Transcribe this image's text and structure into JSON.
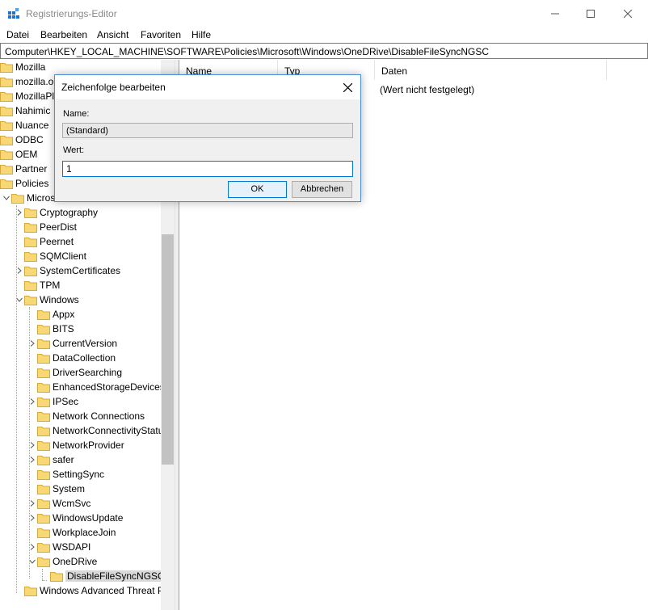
{
  "window": {
    "title": "Registrierungs-Editor"
  },
  "menu": [
    "Datei",
    "Bearbeiten",
    "Ansicht",
    "Favoriten",
    "Hilfe"
  ],
  "address": "Computer\\HKEY_LOCAL_MACHINE\\SOFTWARE\\Policies\\Microsoft\\Windows\\OneDRive\\DisableFileSyncNGSC",
  "tree": [
    {
      "label": "Mozilla",
      "expander": "none",
      "level": 0
    },
    {
      "label": "mozilla.or",
      "expander": "none",
      "level": 0
    },
    {
      "label": "MozillaPlu",
      "expander": "none",
      "level": 0
    },
    {
      "label": "Nahimic",
      "expander": "none",
      "level": 0
    },
    {
      "label": "Nuance",
      "expander": "none",
      "level": 0
    },
    {
      "label": "ODBC",
      "expander": "none",
      "level": 0
    },
    {
      "label": "OEM",
      "expander": "none",
      "level": 0
    },
    {
      "label": "Partner",
      "expander": "none",
      "level": 0
    },
    {
      "label": "Policies",
      "expander": "none",
      "level": 0
    },
    {
      "label": "Micros",
      "expander": "open",
      "level": 1
    },
    {
      "label": "Cryptography",
      "expander": "closed",
      "level": 2
    },
    {
      "label": "PeerDist",
      "expander": "none",
      "level": 2
    },
    {
      "label": "Peernet",
      "expander": "none",
      "level": 2
    },
    {
      "label": "SQMClient",
      "expander": "none",
      "level": 2
    },
    {
      "label": "SystemCertificates",
      "expander": "closed",
      "level": 2
    },
    {
      "label": "TPM",
      "expander": "none",
      "level": 2
    },
    {
      "label": "Windows",
      "expander": "open",
      "level": 2
    },
    {
      "label": "Appx",
      "expander": "none",
      "level": 3
    },
    {
      "label": "BITS",
      "expander": "none",
      "level": 3
    },
    {
      "label": "CurrentVersion",
      "expander": "closed",
      "level": 3
    },
    {
      "label": "DataCollection",
      "expander": "none",
      "level": 3
    },
    {
      "label": "DriverSearching",
      "expander": "none",
      "level": 3
    },
    {
      "label": "EnhancedStorageDevices",
      "expander": "none",
      "level": 3
    },
    {
      "label": "IPSec",
      "expander": "closed",
      "level": 3
    },
    {
      "label": "Network Connections",
      "expander": "none",
      "level": 3
    },
    {
      "label": "NetworkConnectivityStatu",
      "expander": "none",
      "level": 3
    },
    {
      "label": "NetworkProvider",
      "expander": "closed",
      "level": 3
    },
    {
      "label": "safer",
      "expander": "closed",
      "level": 3
    },
    {
      "label": "SettingSync",
      "expander": "none",
      "level": 3
    },
    {
      "label": "System",
      "expander": "none",
      "level": 3
    },
    {
      "label": "WcmSvc",
      "expander": "closed",
      "level": 3
    },
    {
      "label": "WindowsUpdate",
      "expander": "closed",
      "level": 3
    },
    {
      "label": "WorkplaceJoin",
      "expander": "none",
      "level": 3
    },
    {
      "label": "WSDAPI",
      "expander": "closed",
      "level": 3
    },
    {
      "label": "OneDRive",
      "expander": "open",
      "level": 3
    },
    {
      "label": "DisableFileSyncNGSC",
      "expander": "none",
      "level": 4,
      "selected": true
    },
    {
      "label": "Windows Advanced Threat P",
      "expander": "none",
      "level": 2
    }
  ],
  "list": {
    "columns": [
      "Name",
      "Typ",
      "Daten"
    ],
    "rows": [
      {
        "data": "(Wert nicht festgelegt)"
      }
    ]
  },
  "dialog": {
    "title": "Zeichenfolge bearbeiten",
    "name_label": "Name:",
    "name_value": "(Standard)",
    "value_label": "Wert:",
    "value": "1",
    "ok_label": "OK",
    "cancel_label": "Abbrechen"
  }
}
